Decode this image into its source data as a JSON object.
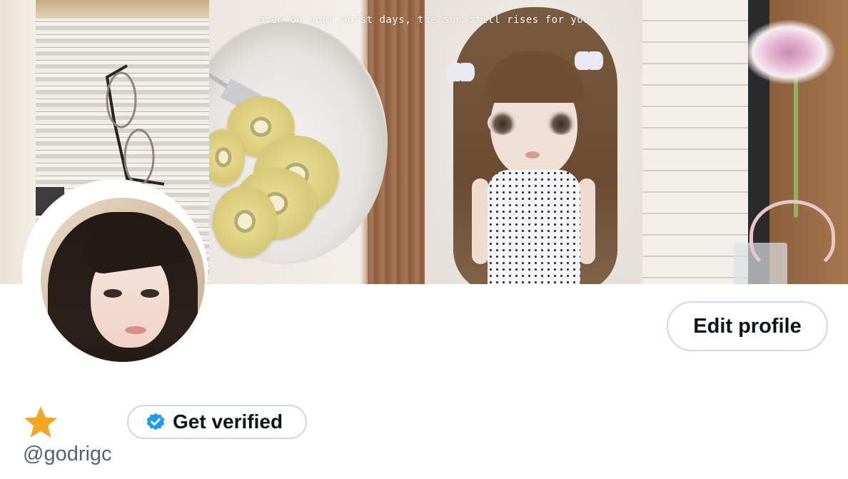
{
  "banner": {
    "caption": "even on your worst days, the sun still rises for you"
  },
  "profile": {
    "edit_label": "Edit profile",
    "get_verified_label": "Get verified",
    "handle": "@godrigc"
  },
  "icons": {
    "name_badge": "star-icon",
    "verify_badge": "verified-check-icon"
  },
  "colors": {
    "star": "#f5a623",
    "verified_blue": "#1d9bf0",
    "border": "#cfd9de",
    "text_primary": "#0f1419",
    "text_secondary": "#536471"
  }
}
